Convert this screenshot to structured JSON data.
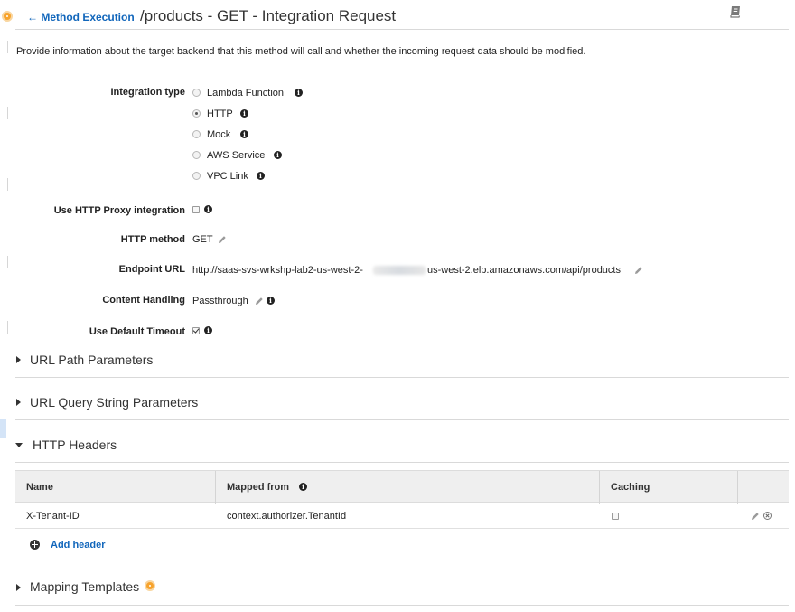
{
  "header": {
    "back_label": "Method Execution",
    "title": "/products - GET - Integration Request"
  },
  "description": "Provide information about the target backend that this method will call and whether the incoming request data should be modified.",
  "integration_type": {
    "label": "Integration type",
    "selected": "HTTP",
    "options": [
      "Lambda Function",
      "HTTP",
      "Mock",
      "AWS Service",
      "VPC Link"
    ]
  },
  "http_proxy": {
    "label": "Use HTTP Proxy integration",
    "checked": false
  },
  "http_method": {
    "label": "HTTP method",
    "value": "GET"
  },
  "endpoint_url": {
    "label": "Endpoint URL",
    "value_prefix": "http://saas-svs-wrkshp-lab2-us-west-2-",
    "value_suffix": "us-west-2.elb.amazonaws.com/api/products"
  },
  "content_handling": {
    "label": "Content Handling",
    "value": "Passthrough"
  },
  "default_timeout": {
    "label": "Use Default Timeout",
    "checked": true
  },
  "sections": {
    "url_path_params": "URL Path Parameters",
    "url_query_params": "URL Query String Parameters",
    "http_headers": "HTTP Headers",
    "mapping_templates": "Mapping Templates"
  },
  "headers_table": {
    "columns": [
      "Name",
      "Mapped from",
      "Caching"
    ],
    "rows": [
      {
        "name": "X-Tenant-ID",
        "mapped_from": "context.authorizer.TenantId",
        "caching": false
      }
    ],
    "add_label": "Add header"
  },
  "colors": {
    "link": "#1166bb",
    "warning": "#f7a32c",
    "table_header": "#efefef"
  }
}
